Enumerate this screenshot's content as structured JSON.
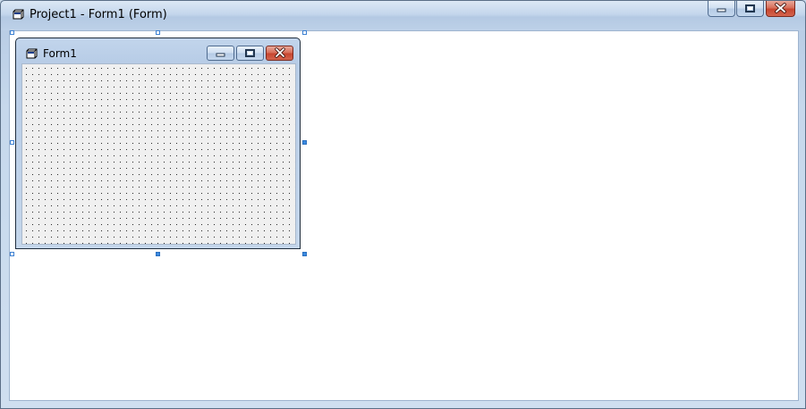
{
  "window": {
    "title": "Project1 - Form1 (Form)",
    "icon": "form-designer-icon",
    "controls": {
      "minimize": "minimize-icon",
      "restore": "restore-icon",
      "close": "close-icon"
    }
  },
  "form": {
    "title": "Form1",
    "icon": "form-designer-icon",
    "controls": {
      "minimize": "minimize-icon",
      "restore": "restore-icon",
      "close": "close-icon"
    },
    "grid": "dotted"
  },
  "colors": {
    "close_button": "#c74630",
    "selection_handle": "#3b8ae0",
    "canvas": "#f0f0f0"
  }
}
